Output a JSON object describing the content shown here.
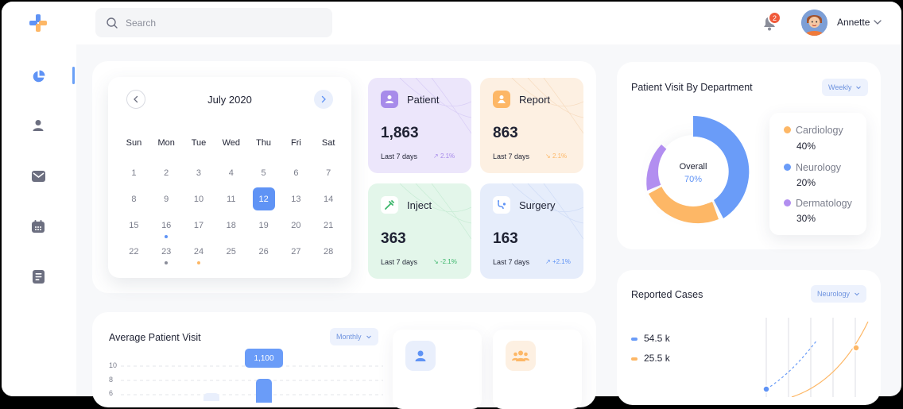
{
  "header": {
    "search_placeholder": "Search",
    "notifications_count": "2",
    "user_name": "Annette"
  },
  "sidebar": {
    "items": [
      {
        "icon": "pie-chart-icon",
        "active": true
      },
      {
        "icon": "user-icon",
        "active": false
      },
      {
        "icon": "mail-icon",
        "active": false
      },
      {
        "icon": "calendar-icon",
        "active": false
      },
      {
        "icon": "document-icon",
        "active": false
      }
    ]
  },
  "calendar": {
    "title": "July 2020",
    "weekdays": [
      "Sun",
      "Mon",
      "Tue",
      "Wed",
      "Thu",
      "Fri",
      "Sat"
    ],
    "weeks": [
      [
        "1",
        "2",
        "3",
        "4",
        "5",
        "6",
        "7"
      ],
      [
        "8",
        "9",
        "10",
        "11",
        "12",
        "13",
        "14"
      ],
      [
        "15",
        "16",
        "17",
        "18",
        "19",
        "20",
        "21"
      ],
      [
        "22",
        "23",
        "24",
        "25",
        "26",
        "27",
        "28"
      ]
    ],
    "selected": "12"
  },
  "stats": [
    {
      "label": "Patient",
      "value": "1,863",
      "period": "Last 7 days",
      "trend": "2.1%",
      "icon": "patient-icon"
    },
    {
      "label": "Report",
      "value": "863",
      "period": "Last 7 days",
      "trend": "2.1%",
      "icon": "report-icon"
    },
    {
      "label": "Inject",
      "value": "363",
      "period": "Last 7 days",
      "trend": "-2.1%",
      "icon": "syringe-icon"
    },
    {
      "label": "Surgery",
      "value": "163",
      "period": "Last 7 days",
      "trend": "+2.1%",
      "icon": "stethoscope-icon"
    }
  ],
  "department": {
    "title": "Patient Visit By Department",
    "filter": "Weekly",
    "center_label": "Overall",
    "center_value": "70%",
    "legend": [
      {
        "name": "Cardiology",
        "value": "40%",
        "color": "#fdb766"
      },
      {
        "name": "Neurology",
        "value": "20%",
        "color": "#6a9cf8"
      },
      {
        "name": "Dermatology",
        "value": "30%",
        "color": "#b28ef0"
      }
    ]
  },
  "cases": {
    "title": "Reported Cases",
    "filter": "Neurology",
    "legend": [
      {
        "value": "54.5 k",
        "color": "#6a9cf8"
      },
      {
        "value": "25.5 k",
        "color": "#fdb766"
      }
    ]
  },
  "average": {
    "title": "Average Patient Visit",
    "filter": "Monthly",
    "tooltip": "1,100",
    "y_ticks": [
      "10",
      "8",
      "6"
    ]
  },
  "colors": {
    "accent": "#5f93f5",
    "patient_bg": "#ece6fb",
    "report_bg": "#fdf0e2",
    "inject_bg": "#e3f6ea",
    "surgery_bg": "#e6edfb"
  }
}
